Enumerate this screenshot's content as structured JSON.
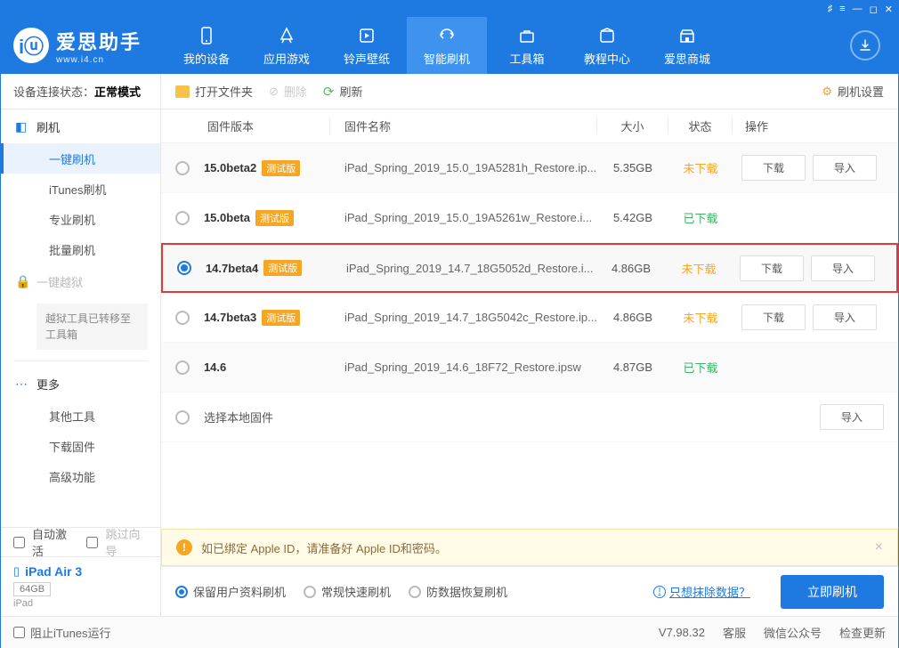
{
  "brand": {
    "name": "爱思助手",
    "sub": "www.i4.cn"
  },
  "nav": {
    "items": [
      "我的设备",
      "应用游戏",
      "铃声壁纸",
      "智能刷机",
      "工具箱",
      "教程中心",
      "爱思商城"
    ],
    "active": 3
  },
  "status": {
    "label": "设备连接状态：",
    "value": "正常模式"
  },
  "sidebar": {
    "flash": "刷机",
    "subs": [
      "一键刷机",
      "iTunes刷机",
      "专业刷机",
      "批量刷机"
    ],
    "jailbreak": "一键越狱",
    "jb_note": "越狱工具已转移至工具箱",
    "more": "更多",
    "more_subs": [
      "其他工具",
      "下载固件",
      "高级功能"
    ],
    "auto": "自动激活",
    "skip": "跳过向导"
  },
  "device": {
    "name": "iPad Air 3",
    "storage": "64GB",
    "type": "iPad"
  },
  "toolbar": {
    "open": "打开文件夹",
    "delete": "删除",
    "refresh": "刷新",
    "settings": "刷机设置"
  },
  "table": {
    "headers": {
      "ver": "固件版本",
      "name": "固件名称",
      "size": "大小",
      "status": "状态",
      "ops": "操作"
    },
    "beta": "测试版",
    "btn_dl": "下载",
    "btn_imp": "导入",
    "rows": [
      {
        "v": "15.0beta2",
        "b": true,
        "n": "iPad_Spring_2019_15.0_19A5281h_Restore.ip...",
        "s": "5.35GB",
        "st": "未下载",
        "dl": true,
        "imp": true
      },
      {
        "v": "15.0beta",
        "b": true,
        "n": "iPad_Spring_2019_15.0_19A5261w_Restore.i...",
        "s": "5.42GB",
        "st": "已下载"
      },
      {
        "v": "14.7beta4",
        "b": true,
        "n": "iPad_Spring_2019_14.7_18G5052d_Restore.i...",
        "s": "4.86GB",
        "st": "未下载",
        "dl": true,
        "imp": true,
        "sel": true
      },
      {
        "v": "14.7beta3",
        "b": true,
        "n": "iPad_Spring_2019_14.7_18G5042c_Restore.ip...",
        "s": "4.86GB",
        "st": "未下载",
        "dl": true,
        "imp": true
      },
      {
        "v": "14.6",
        "b": false,
        "n": "iPad_Spring_2019_14.6_18F72_Restore.ipsw",
        "s": "4.87GB",
        "st": "已下载"
      },
      {
        "v": "选择本地固件",
        "b": false,
        "n": "",
        "s": "",
        "st": "",
        "imp": true,
        "local": true
      }
    ]
  },
  "notice": "如已绑定 Apple ID，请准备好 Apple ID和密码。",
  "actions": {
    "opts": [
      "保留用户资料刷机",
      "常规快速刷机",
      "防数据恢复刷机"
    ],
    "erase": "只想抹除数据？",
    "go": "立即刷机"
  },
  "footer": {
    "block": "阻止iTunes运行",
    "ver": "V7.98.32",
    "links": [
      "客服",
      "微信公众号",
      "检查更新"
    ]
  }
}
